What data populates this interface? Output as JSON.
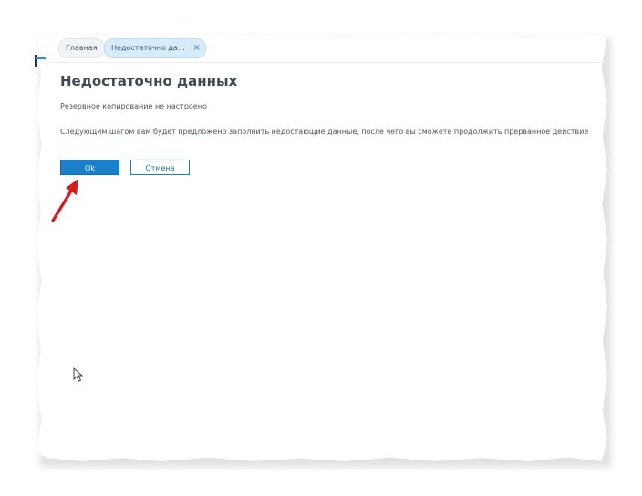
{
  "tabs": {
    "home_label": "Главная",
    "active_label": "Недостаточно да…",
    "close_glyph": "×"
  },
  "dialog": {
    "title": "Недостаточно данных",
    "subtitle": "Резервное копирование не настроено",
    "message": "Следующим шагом вам будет предложено заполнить недостающие данные, после чего вы сможете продолжить прерванное действие",
    "ok_label": "Ok",
    "cancel_label": "Отмена"
  },
  "colors": {
    "primary": "#1b7fc9",
    "tab_active_bg": "#d7ecfa",
    "arrow": "#d71a1a"
  },
  "icons": {
    "annotation": "red-arrow-icon",
    "pointer": "mouse-cursor-icon",
    "close": "close-icon"
  }
}
